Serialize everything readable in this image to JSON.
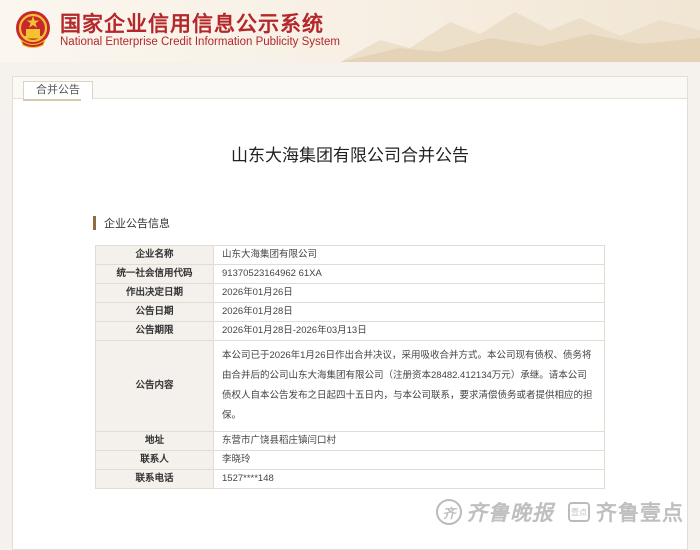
{
  "site": {
    "title_cn": "国家企业信用信息公示系统",
    "title_en": "National Enterprise Credit Information Publicity System"
  },
  "tab": {
    "label": "合并公告"
  },
  "notice": {
    "title": "山东大海集团有限公司合并公告"
  },
  "section": {
    "label": "企业公告信息"
  },
  "rows": [
    {
      "key": "企业名称",
      "value": "山东大海集团有限公司"
    },
    {
      "key": "统一社会信用代码",
      "value": "91370523164962 61XA"
    },
    {
      "key": "作出决定日期",
      "value": "2026年01月26日"
    },
    {
      "key": "公告日期",
      "value": "2026年01月28日"
    },
    {
      "key": "公告期限",
      "value": "2026年01月28日-2026年03月13日"
    },
    {
      "key": "公告内容",
      "value": "本公司已于2026年1月26日作出合并决议，采用吸收合并方式。本公司现有债权、债务将由合并后的公司山东大海集团有限公司（注册资本28482.412134万元）承继。请本公司债权人自本公告发布之日起四十五日内，与本公司联系，要求清偿债务或者提供相应的担保。"
    },
    {
      "key": "地址",
      "value": "东营市广饶县稻庄镇闫口村"
    },
    {
      "key": "联系人",
      "value": "李晓玲"
    },
    {
      "key": "联系电话",
      "value": "1527****148"
    }
  ],
  "watermark": {
    "seal_char": "齐",
    "brand1": "齐鲁晚报",
    "badge": "壹点",
    "brand2": "齐鲁壹点"
  },
  "colors": {
    "brand_red": "#b4272b",
    "section_bar": "#8f6b3e",
    "label_bg": "#f4f1ec"
  }
}
